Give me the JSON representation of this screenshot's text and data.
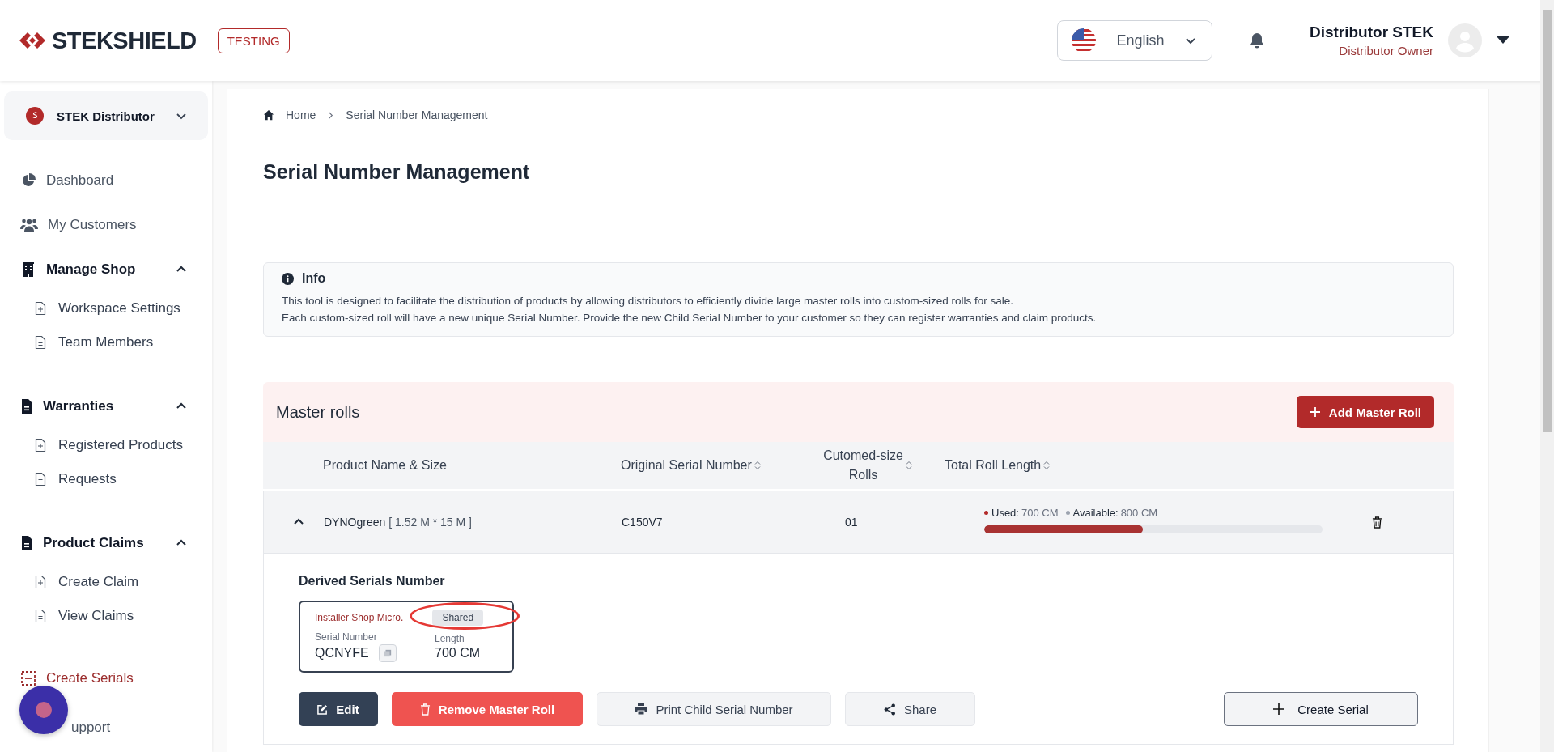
{
  "header": {
    "logo": "STEKSHIELD",
    "env_badge": "TESTING",
    "language": {
      "label": "English"
    },
    "user": {
      "name": "Distributor STEK",
      "role": "Distributor Owner"
    }
  },
  "sidebar": {
    "org": "STEK Distributor",
    "items": [
      {
        "kind": "link",
        "label": "Dashboard",
        "selected": false
      },
      {
        "kind": "link",
        "label": "My Customers",
        "selected": false
      },
      {
        "kind": "section",
        "label": "Manage Shop",
        "expanded": true,
        "children": [
          {
            "label": "Workspace Settings",
            "selected": false
          },
          {
            "label": "Team Members",
            "selected": false
          }
        ]
      },
      {
        "kind": "section",
        "label": "Warranties",
        "expanded": true,
        "children": [
          {
            "label": "Registered Products",
            "selected": false
          },
          {
            "label": "Requests",
            "selected": false
          }
        ]
      },
      {
        "kind": "section",
        "label": "Product Claims",
        "expanded": true,
        "children": [
          {
            "label": "Create Claim",
            "selected": false
          },
          {
            "label": "View Claims",
            "selected": false
          }
        ]
      },
      {
        "kind": "link",
        "label": "Create Serials",
        "selected": true
      },
      {
        "kind": "link",
        "label": "upport",
        "selected": false
      }
    ]
  },
  "main": {
    "breadcrumb": [
      {
        "label": "Home"
      },
      {
        "label": "Serial Number Management"
      }
    ],
    "title": "Serial Number Management",
    "info": {
      "title": "Info",
      "lines": [
        "This tool is designed to facilitate the distribution of products by allowing distributors to efficiently divide large master rolls into custom-sized rolls for sale.",
        "Each custom-sized roll will have a new unique Serial Number. Provide the new Child Serial Number to your customer so they can register warranties and claim products."
      ]
    },
    "master_rolls": {
      "title": "Master rolls",
      "add_button": "Add Master Roll",
      "columns": [
        {
          "label": "Product Name & Size",
          "sortable": false
        },
        {
          "label": "Original Serial Number",
          "sortable": true
        },
        {
          "label": "Cutomed-size Rolls",
          "sortable": true
        },
        {
          "label": "Total Roll Length",
          "sortable": true
        }
      ],
      "rows": [
        {
          "expanded": true,
          "product": "DYNOgreen",
          "size": "[ 1.52 M * 15 M ]",
          "serial": "C150V7",
          "rolls": "01",
          "used_label": "Used:",
          "used": "700 CM",
          "available_label": "Available:",
          "available": "800 CM",
          "level": 0.47,
          "derived_title": "Derived Serials Number",
          "derived": [
            {
              "owner": "Installer Shop Micro.",
              "status": "Shared",
              "highlighted": true,
              "serial_label": "Serial Number",
              "serial": "QCNYFE",
              "length_label": "Length",
              "length": "700 CM"
            }
          ],
          "actions": [
            {
              "kind": "edit",
              "label": "Edit"
            },
            {
              "kind": "remove",
              "label": "Remove Master Roll"
            },
            {
              "kind": "print",
              "label": "Print Child Serial Number"
            },
            {
              "kind": "share",
              "label": "Share"
            },
            {
              "kind": "create",
              "label": "Create Serial"
            }
          ]
        }
      ]
    }
  }
}
